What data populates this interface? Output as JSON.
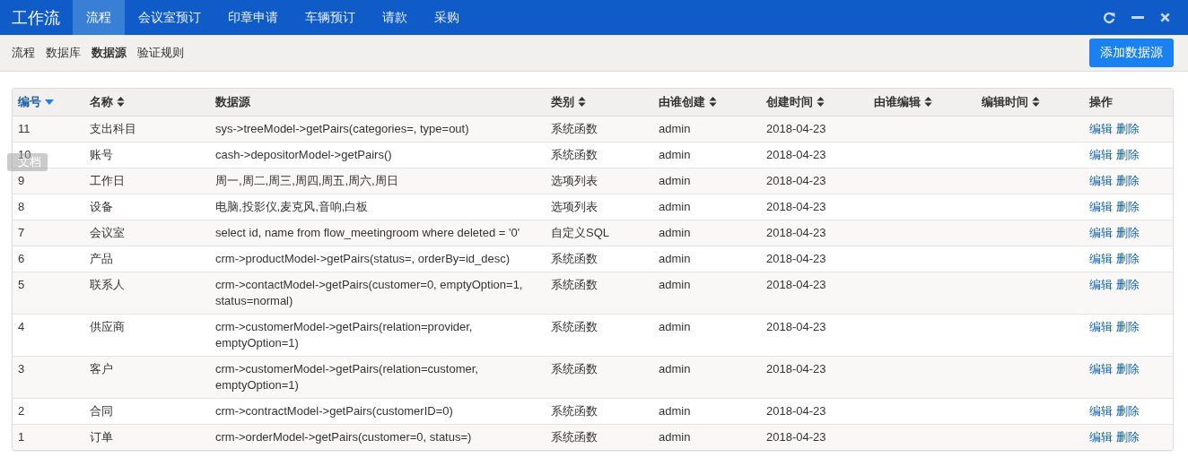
{
  "app": {
    "title": "工作流"
  },
  "nav_tabs": [
    {
      "label": "流程",
      "selected": true
    },
    {
      "label": "会议室预订",
      "selected": false
    },
    {
      "label": "印章申请",
      "selected": false
    },
    {
      "label": "车辆预订",
      "selected": false
    },
    {
      "label": "请款",
      "selected": false
    },
    {
      "label": "采购",
      "selected": false
    }
  ],
  "sub_nav": [
    {
      "label": "流程",
      "selected": false
    },
    {
      "label": "数据库",
      "selected": false
    },
    {
      "label": "数据源",
      "selected": true
    },
    {
      "label": "验证规则",
      "selected": false
    }
  ],
  "add_button": "添加数据源",
  "doc_tab": "文档",
  "table": {
    "columns": [
      {
        "label": "编号",
        "sortable": true,
        "sorted": true
      },
      {
        "label": "名称",
        "sortable": true,
        "sorted": false
      },
      {
        "label": "数据源",
        "sortable": false,
        "sorted": false
      },
      {
        "label": "类别",
        "sortable": true,
        "sorted": false
      },
      {
        "label": "由谁创建",
        "sortable": true,
        "sorted": false
      },
      {
        "label": "创建时间",
        "sortable": true,
        "sorted": false
      },
      {
        "label": "由谁编辑",
        "sortable": true,
        "sorted": false
      },
      {
        "label": "编辑时间",
        "sortable": true,
        "sorted": false
      },
      {
        "label": "操作",
        "sortable": false,
        "sorted": false
      }
    ],
    "rows": [
      {
        "id": "11",
        "name": "支出科目",
        "source": "sys->treeModel->getPairs(categories=, type=out)",
        "type": "系统函数",
        "created_by": "admin",
        "created": "2018-04-23",
        "actions": [
          "编辑",
          "删除"
        ]
      },
      {
        "id": "10",
        "name": "账号",
        "source": "cash->depositorModel->getPairs()",
        "type": "系统函数",
        "created_by": "admin",
        "created": "2018-04-23",
        "actions": [
          "编辑",
          "删除"
        ]
      },
      {
        "id": "9",
        "name": "工作日",
        "source": "周一,周二,周三,周四,周五,周六,周日",
        "type": "选项列表",
        "created_by": "admin",
        "created": "2018-04-23",
        "actions": [
          "编辑",
          "删除"
        ]
      },
      {
        "id": "8",
        "name": "设备",
        "source": "电脑,投影仪,麦克风,音响,白板",
        "type": "选项列表",
        "created_by": "admin",
        "created": "2018-04-23",
        "actions": [
          "编辑",
          "删除"
        ]
      },
      {
        "id": "7",
        "name": "会议室",
        "source": "select id, name from flow_meetingroom where deleted = '0'",
        "type": "自定义SQL",
        "created_by": "admin",
        "created": "2018-04-23",
        "actions": [
          "编辑",
          "删除"
        ]
      },
      {
        "id": "6",
        "name": "产品",
        "source": "crm->productModel->getPairs(status=, orderBy=id_desc)",
        "type": "系统函数",
        "created_by": "admin",
        "created": "2018-04-23",
        "actions": [
          "编辑",
          "删除"
        ]
      },
      {
        "id": "5",
        "name": "联系人",
        "source": "crm->contactModel->getPairs(customer=0, emptyOption=1, status=normal)",
        "type": "系统函数",
        "created_by": "admin",
        "created": "2018-04-23",
        "actions": [
          "编辑",
          "删除"
        ]
      },
      {
        "id": "4",
        "name": "供应商",
        "source": "crm->customerModel->getPairs(relation=provider, emptyOption=1)",
        "type": "系统函数",
        "created_by": "admin",
        "created": "2018-04-23",
        "actions": [
          "编辑",
          "删除"
        ]
      },
      {
        "id": "3",
        "name": "客户",
        "source": "crm->customerModel->getPairs(relation=customer, emptyOption=1)",
        "type": "系统函数",
        "created_by": "admin",
        "created": "2018-04-23",
        "actions": [
          "编辑",
          "删除"
        ]
      },
      {
        "id": "2",
        "name": "合同",
        "source": "crm->contractModel->getPairs(customerID=0)",
        "type": "系统函数",
        "created_by": "admin",
        "created": "2018-04-23",
        "actions": [
          "编辑",
          "删除"
        ]
      },
      {
        "id": "1",
        "name": "订单",
        "source": "crm->orderModel->getPairs(customer=0, status=)",
        "type": "系统函数",
        "created_by": "admin",
        "created": "2018-04-23",
        "actions": [
          "编辑",
          "删除"
        ]
      }
    ]
  }
}
